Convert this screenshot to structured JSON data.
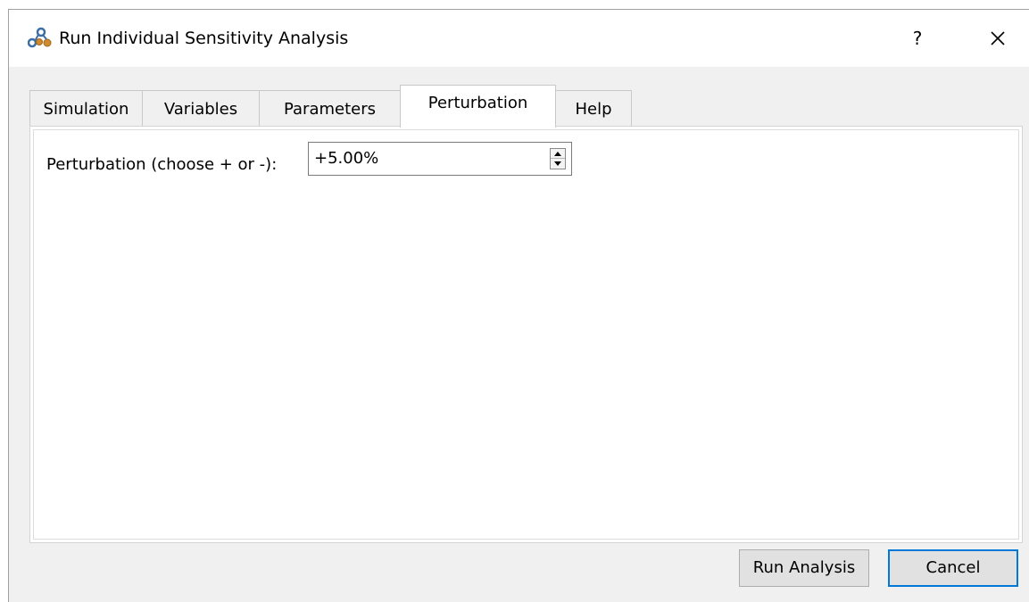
{
  "window": {
    "title": "Run Individual Sensitivity Analysis",
    "help_label": "?",
    "icon": "app-icon"
  },
  "tabs": [
    {
      "label": "Simulation",
      "active": false
    },
    {
      "label": "Variables",
      "active": false
    },
    {
      "label": "Parameters",
      "active": false
    },
    {
      "label": "Perturbation",
      "active": true
    },
    {
      "label": "Help",
      "active": false
    }
  ],
  "perturbation": {
    "label": "Perturbation (choose + or -):",
    "value": "+5.00%"
  },
  "buttons": {
    "run_label": "Run Analysis",
    "cancel_label": "Cancel"
  },
  "colors": {
    "accent": "#0078d7",
    "window_bg": "#f0f0f0",
    "panel_bg": "#ffffff"
  }
}
